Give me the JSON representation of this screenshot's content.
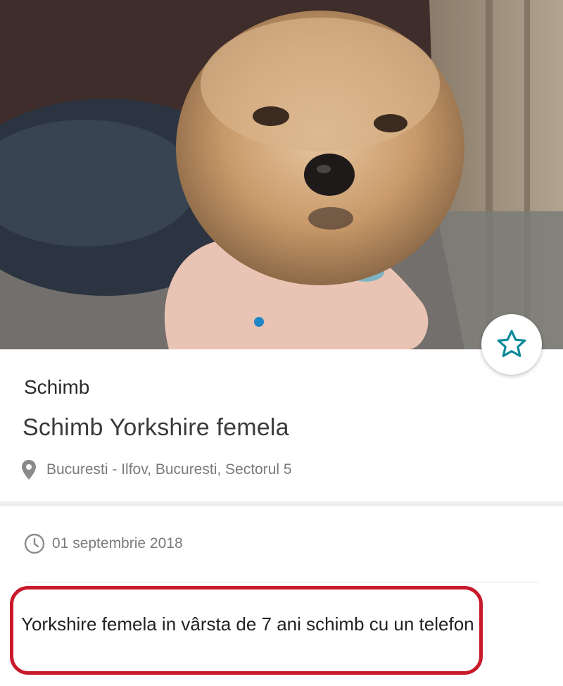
{
  "listing": {
    "category": "Schimb",
    "title": "Schimb Yorkshire femela",
    "location": "Bucuresti - Ilfov, Bucuresti, Sectorul 5",
    "date": "01 septembrie 2018",
    "description": "Yorkshire femela in vârsta de 7 ani schimb cu un telefon"
  },
  "colors": {
    "accent": "#1f86c5",
    "highlight_border": "#c8192b",
    "star_outline": "#0e8a9a"
  },
  "icons": {
    "favorite": "star-icon",
    "location": "map-pin-icon",
    "date": "clock-icon",
    "gallery_indicator": "page-dot"
  }
}
